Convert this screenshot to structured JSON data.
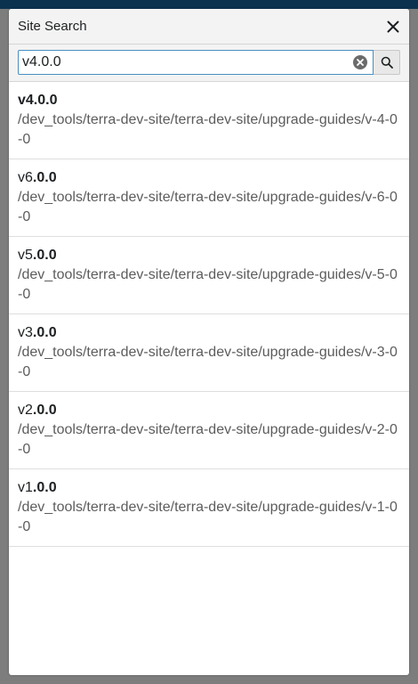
{
  "modal": {
    "title": "Site Search",
    "close_icon": "close-icon"
  },
  "search": {
    "value": "v4.0.0",
    "clear_icon": "clear-circle-icon",
    "submit_icon": "search-icon"
  },
  "results": [
    {
      "title_prefix": "v4.0.0",
      "title_match": "",
      "path": "/dev_tools/terra-dev-site/terra-dev-site/upgrade-guides/v-4-0-0"
    },
    {
      "title_prefix": "v6",
      "title_match": ".0.0",
      "path": "/dev_tools/terra-dev-site/terra-dev-site/upgrade-guides/v-6-0-0"
    },
    {
      "title_prefix": "v5",
      "title_match": ".0.0",
      "path": "/dev_tools/terra-dev-site/terra-dev-site/upgrade-guides/v-5-0-0"
    },
    {
      "title_prefix": "v3",
      "title_match": ".0.0",
      "path": "/dev_tools/terra-dev-site/terra-dev-site/upgrade-guides/v-3-0-0"
    },
    {
      "title_prefix": "v2",
      "title_match": ".0.0",
      "path": "/dev_tools/terra-dev-site/terra-dev-site/upgrade-guides/v-2-0-0"
    },
    {
      "title_prefix": "v1",
      "title_match": ".0.0",
      "path": "/dev_tools/terra-dev-site/terra-dev-site/upgrade-guides/v-1-0-0"
    }
  ],
  "colors": {
    "header_bg": "#0b3350",
    "overlay": "#7d7d7d",
    "input_border": "#4a90c2"
  }
}
